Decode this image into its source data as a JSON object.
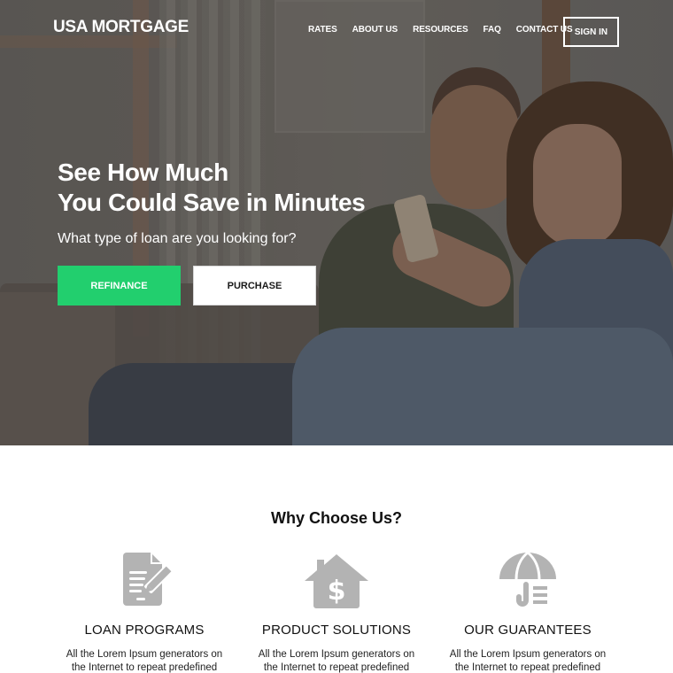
{
  "brand": {
    "name": "USA MORTGAGE"
  },
  "nav": {
    "items": [
      {
        "label": "RATES"
      },
      {
        "label": "ABOUT US"
      },
      {
        "label": "RESOURCES"
      },
      {
        "label": "FAQ"
      },
      {
        "label": "CONTACT US"
      }
    ],
    "signin_label": "SIGN IN"
  },
  "hero": {
    "headline_line1": "See How Much",
    "headline_line2": "You Could Save in Minutes",
    "subheadline": "What type of loan are you looking for?",
    "buttons": {
      "refinance": "REFINANCE",
      "purchase": "PURCHASE"
    },
    "image_description": "smiling couple on a sofa looking at a phone"
  },
  "why": {
    "title": "Why Choose Us?",
    "features": [
      {
        "icon": "document-edit-icon",
        "title": "LOAN PROGRAMS",
        "text_line1": "All the Lorem Ipsum generators on",
        "text_line2": "the Internet to repeat predefined"
      },
      {
        "icon": "house-dollar-icon",
        "title": "PRODUCT SOLUTIONS",
        "text_line1": "All the Lorem Ipsum generators on",
        "text_line2": "the Internet to repeat predefined"
      },
      {
        "icon": "umbrella-icon",
        "title": "OUR GUARANTEES",
        "text_line1": "All the Lorem Ipsum generators on",
        "text_line2": "the Internet to repeat predefined"
      }
    ]
  },
  "colors": {
    "accent_green": "#22cf6e",
    "icon_gray": "#b3b3b3",
    "text_dark": "#111111"
  }
}
